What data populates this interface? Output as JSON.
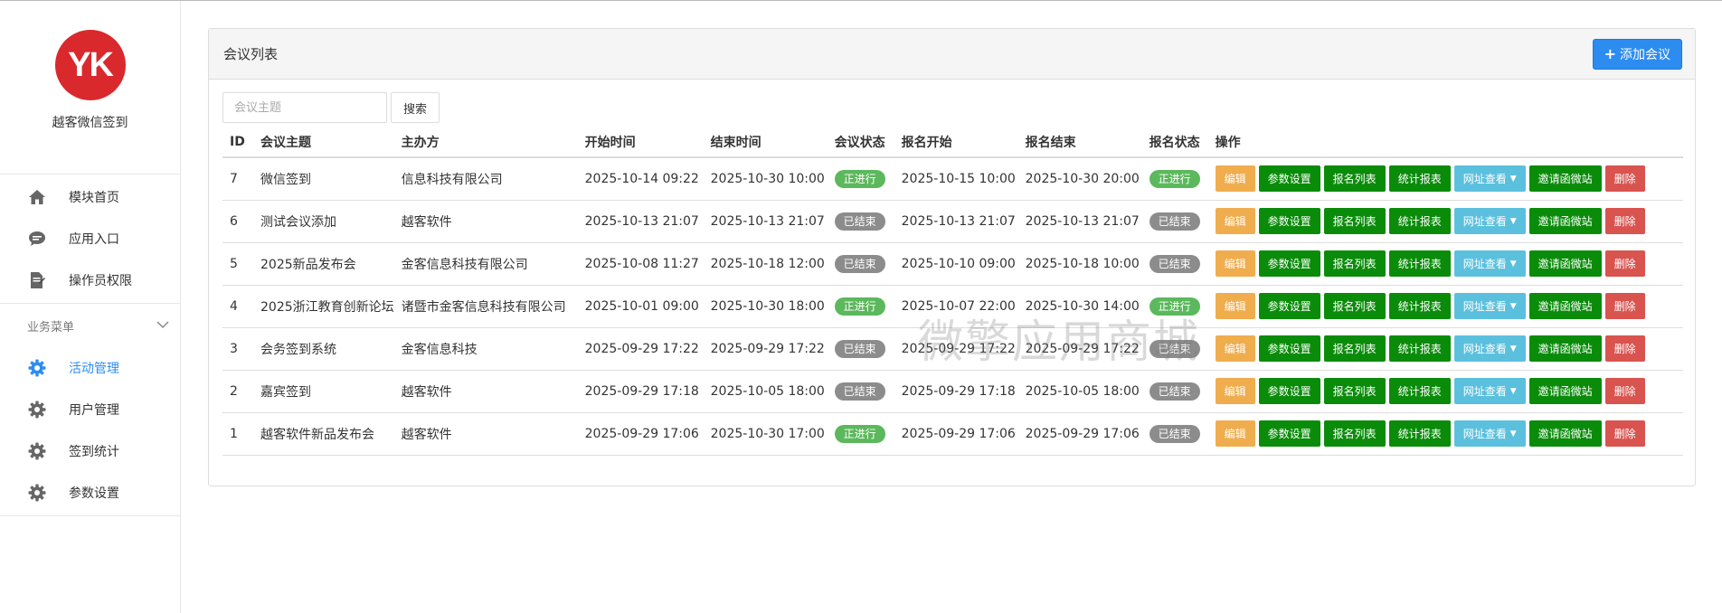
{
  "sidebar": {
    "logo_text": "YK",
    "brand": "越客微信签到",
    "top_items": [
      {
        "label": "模块首页",
        "icon": "home-icon"
      },
      {
        "label": "应用入口",
        "icon": "chat-bubble-icon"
      },
      {
        "label": "操作员权限",
        "icon": "document-edit-icon"
      }
    ],
    "section_title": "业务菜单",
    "business_items": [
      {
        "label": "活动管理",
        "icon": "gear-icon",
        "active": true
      },
      {
        "label": "用户管理",
        "icon": "gear-icon",
        "active": false
      },
      {
        "label": "签到统计",
        "icon": "gear-icon",
        "active": false
      },
      {
        "label": "参数设置",
        "icon": "gear-icon",
        "active": false
      }
    ]
  },
  "panel": {
    "title": "会议列表",
    "add_button": "添加会议",
    "search_placeholder": "会议主题",
    "search_button": "搜索"
  },
  "table": {
    "headers": [
      "ID",
      "会议主题",
      "主办方",
      "开始时间",
      "结束时间",
      "会议状态",
      "报名开始",
      "报名结束",
      "报名状态",
      "操作"
    ],
    "rows": [
      {
        "id": "7",
        "topic": "微信签到",
        "host": "信息科技有限公司",
        "start": "2025-10-14 09:22",
        "end": "2025-10-30 10:00",
        "status": "正进行",
        "reg_start": "2025-10-15 10:00",
        "reg_end": "2025-10-30 20:00",
        "reg_status": "正进行"
      },
      {
        "id": "6",
        "topic": "测试会议添加",
        "host": "越客软件",
        "start": "2025-10-13 21:07",
        "end": "2025-10-13 21:07",
        "status": "已结束",
        "reg_start": "2025-10-13 21:07",
        "reg_end": "2025-10-13 21:07",
        "reg_status": "已结束"
      },
      {
        "id": "5",
        "topic": "2025新品发布会",
        "host": "金客信息科技有限公司",
        "start": "2025-10-08 11:27",
        "end": "2025-10-18 12:00",
        "status": "已结束",
        "reg_start": "2025-10-10 09:00",
        "reg_end": "2025-10-18 10:00",
        "reg_status": "已结束"
      },
      {
        "id": "4",
        "topic": "2025浙江教育创新论坛",
        "host": "诸暨市金客信息科技有限公司",
        "start": "2025-10-01 09:00",
        "end": "2025-10-30 18:00",
        "status": "正进行",
        "reg_start": "2025-10-07 22:00",
        "reg_end": "2025-10-30 14:00",
        "reg_status": "正进行"
      },
      {
        "id": "3",
        "topic": "会务签到系统",
        "host": "金客信息科技",
        "start": "2025-09-29 17:22",
        "end": "2025-09-29 17:22",
        "status": "已结束",
        "reg_start": "2025-09-29 17:22",
        "reg_end": "2025-09-29 17:22",
        "reg_status": "已结束"
      },
      {
        "id": "2",
        "topic": "嘉宾签到",
        "host": "越客软件",
        "start": "2025-09-29 17:18",
        "end": "2025-10-05 18:00",
        "status": "已结束",
        "reg_start": "2025-09-29 17:18",
        "reg_end": "2025-10-05 18:00",
        "reg_status": "已结束"
      },
      {
        "id": "1",
        "topic": "越客软件新品发布会",
        "host": "越客软件",
        "start": "2025-09-29 17:06",
        "end": "2025-10-30 17:00",
        "status": "正进行",
        "reg_start": "2025-09-29 17:06",
        "reg_end": "2025-09-29 17:06",
        "reg_status": "已结束"
      }
    ],
    "actions": {
      "edit": "编辑",
      "params": "参数设置",
      "reg_list": "报名列表",
      "stats": "统计报表",
      "url_view": "网址查看",
      "invite": "邀请函微站",
      "delete": "删除"
    }
  },
  "watermark": "微擎应用商城",
  "colors": {
    "logo_red": "#d9292d",
    "accent_blue": "#2d8cf0",
    "status_ongoing": "#5cb85c",
    "status_ended": "#8c8c8c",
    "btn_edit": "#f0ad4e",
    "btn_green": "#0a8c0a",
    "btn_info": "#5bc0de",
    "btn_danger": "#d9534f"
  }
}
